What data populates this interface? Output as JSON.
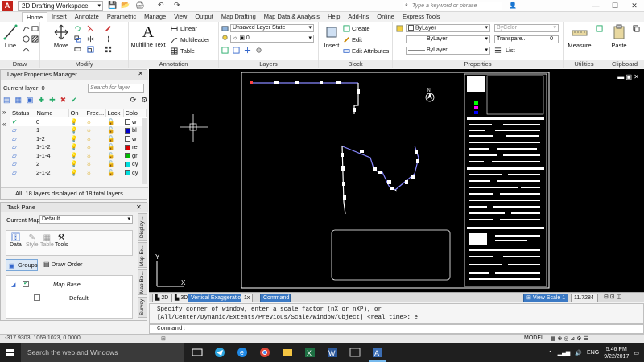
{
  "titlebar": {
    "app_letter": "A",
    "workspace": "2D Drafting Workspace",
    "search_placeholder": "Type a keyword or phrase"
  },
  "tabs": [
    "Home",
    "Insert",
    "Annotate",
    "Parametric",
    "Manage",
    "View",
    "Output",
    "Map Drafting",
    "Map Data & Analysis",
    "Help",
    "Add-Ins",
    "Online",
    "Express Tools"
  ],
  "ribbon": {
    "draw": {
      "title": "Draw",
      "line": "Line"
    },
    "modify": {
      "title": "Modify",
      "move": "Move"
    },
    "annotation": {
      "title": "Annotation",
      "text": "Multiline Text",
      "linear": "Linear",
      "multileader": "Multileader",
      "table": "Table"
    },
    "layers": {
      "title": "Layers",
      "state": "Unsaved Layer State",
      "layer": "0"
    },
    "block": {
      "title": "Block",
      "insert": "Insert",
      "create": "Create",
      "edit": "Edit",
      "edit_attr": "Edit Attributes"
    },
    "properties": {
      "title": "Properties",
      "color": "ByLayer",
      "linetype": "ByLayer",
      "lineweight": "ByLayer",
      "bycolor": "ByColor",
      "transparency": "Transpare...",
      "transparency_value": "0",
      "list": "List"
    },
    "utilities": {
      "title": "Utilities",
      "measure": "Measure"
    },
    "clipboard": {
      "title": "Clipboard",
      "paste": "Paste"
    }
  },
  "lpm": {
    "title": "Layer Properties Manager",
    "current_layer": "Current layer: 0",
    "search_placeholder": "Search for layer",
    "columns": [
      "Status",
      "Name",
      "On",
      "Free...",
      "Lock",
      "Colo"
    ],
    "rows": [
      {
        "name": "0",
        "color": "#ffffff",
        "color_label": "w"
      },
      {
        "name": "1",
        "color": "#0000cc",
        "color_label": "bl"
      },
      {
        "name": "1-2",
        "color": "#ffffff",
        "color_label": "w"
      },
      {
        "name": "1-1-2",
        "color": "#dd0000",
        "color_label": "re"
      },
      {
        "name": "1-1-4",
        "color": "#00bb00",
        "color_label": "gr"
      },
      {
        "name": "2",
        "color": "#00dddd",
        "color_label": "cy"
      },
      {
        "name": "2-1-2",
        "color": "#00dddd",
        "color_label": "cy"
      }
    ],
    "status": "All: 18 layers displayed of 18 total layers"
  },
  "taskpane": {
    "title": "Task Pane",
    "current_map_label": "Current Map:",
    "current_map": "Default",
    "tools": [
      "Data",
      "Style",
      "Table",
      "Tools"
    ],
    "groups": "Groups",
    "draw_order": "Draw Order",
    "tree_root": "Map Base",
    "tree_child": "Default",
    "vtabs": [
      "Display ...",
      "Map Ex...",
      "Map Bo...",
      "Survey"
    ]
  },
  "modeltabs": {
    "t2d": "2D",
    "t3d": "3D",
    "vertical": "Vertical Exaggeration",
    "vertical_value": "1x",
    "command": "Command",
    "viewscale": "View Scale",
    "viewscale_a": "1",
    "viewscale_b": "11.7284"
  },
  "command": {
    "history1": "Specify corner of window, enter a scale factor (nX or nXP), or",
    "history2": "[All/Center/Dynamic/Extents/Previous/Scale/Window/Object] <real time>: e",
    "prompt": "Command:"
  },
  "status": {
    "coords": "-317.9303, 1069.1023, 0.0000",
    "model": "MODEL"
  },
  "taskbar": {
    "search": "Search the web and Windows",
    "lang": "ENG",
    "time": "5:46 PM",
    "date": "9/22/2017"
  }
}
